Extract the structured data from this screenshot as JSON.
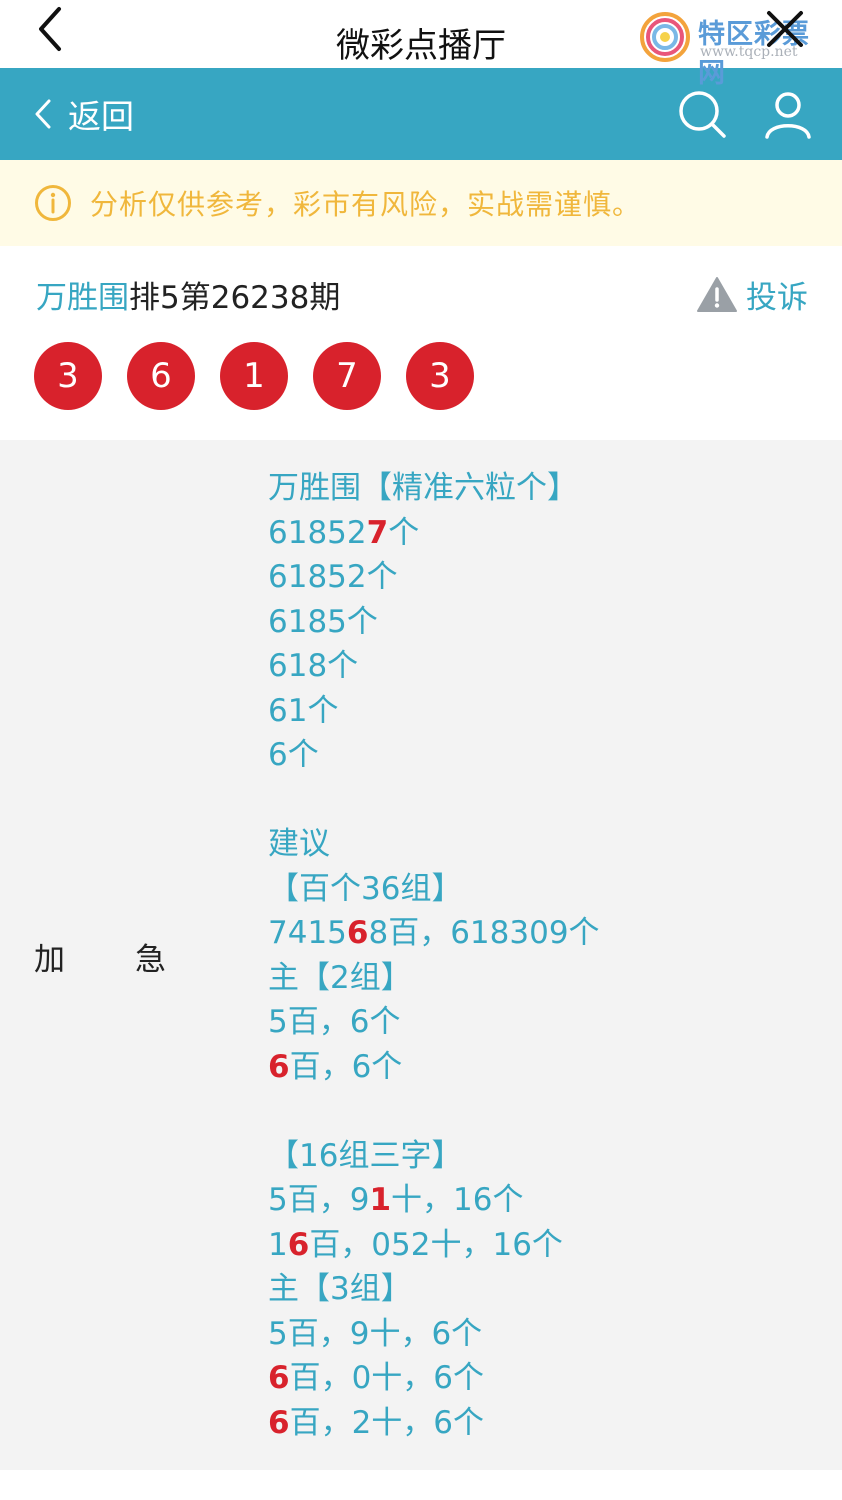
{
  "topbar": {
    "title": "微彩点播厅"
  },
  "watermark": {
    "brand": "特区彩票网",
    "url": "www.tqcp.net"
  },
  "navbar": {
    "back_label": "返回"
  },
  "notice": {
    "text": "分析仅供参考，彩市有风险，实战需谨慎。"
  },
  "post": {
    "author": "万胜围",
    "title_rest": "排5第26238期",
    "complain_label": "投诉",
    "balls": [
      "3",
      "6",
      "1",
      "7",
      "3"
    ]
  },
  "content": {
    "label_left": "加",
    "label_right": "急",
    "lines": [
      {
        "segments": [
          {
            "t": "万胜围【精准六粒个】"
          }
        ]
      },
      {
        "segments": [
          {
            "t": "61852"
          },
          {
            "t": "7",
            "hl": true
          },
          {
            "t": "个"
          }
        ]
      },
      {
        "segments": [
          {
            "t": "61852个"
          }
        ]
      },
      {
        "segments": [
          {
            "t": "6185个"
          }
        ]
      },
      {
        "segments": [
          {
            "t": "618个"
          }
        ]
      },
      {
        "segments": [
          {
            "t": "61个"
          }
        ]
      },
      {
        "segments": [
          {
            "t": "6个"
          }
        ]
      },
      {
        "segments": []
      },
      {
        "segments": [
          {
            "t": "建议"
          }
        ]
      },
      {
        "segments": [
          {
            "t": "【百个36组】"
          }
        ]
      },
      {
        "segments": [
          {
            "t": "7415"
          },
          {
            "t": "6",
            "hl": true
          },
          {
            "t": "8百，618309个"
          }
        ]
      },
      {
        "segments": [
          {
            "t": "主【2组】"
          }
        ]
      },
      {
        "segments": [
          {
            "t": "5百，6个"
          }
        ]
      },
      {
        "segments": [
          {
            "t": "6",
            "hl": true
          },
          {
            "t": "百，6个"
          }
        ]
      },
      {
        "segments": []
      },
      {
        "segments": [
          {
            "t": "【16组三字】"
          }
        ]
      },
      {
        "segments": [
          {
            "t": "5百，9"
          },
          {
            "t": "1",
            "hl": true
          },
          {
            "t": "十，16个"
          }
        ]
      },
      {
        "segments": [
          {
            "t": "1"
          },
          {
            "t": "6",
            "hl": true
          },
          {
            "t": "百，052十，16个"
          }
        ]
      },
      {
        "segments": [
          {
            "t": "主【3组】"
          }
        ]
      },
      {
        "segments": [
          {
            "t": "5百，9十，6个"
          }
        ]
      },
      {
        "segments": [
          {
            "t": "6",
            "hl": true
          },
          {
            "t": "百，0十，6个"
          }
        ]
      },
      {
        "segments": [
          {
            "t": "6",
            "hl": true
          },
          {
            "t": "百，2十，6个"
          }
        ]
      }
    ]
  },
  "colors": {
    "teal": "#37a6c2",
    "red": "#d8222c",
    "notice_text": "#f0b73c",
    "notice_bg": "#fffbe6"
  },
  "icons": [
    "chevron-left-icon",
    "close-icon",
    "search-icon",
    "user-icon",
    "info-icon",
    "warning-icon"
  ]
}
